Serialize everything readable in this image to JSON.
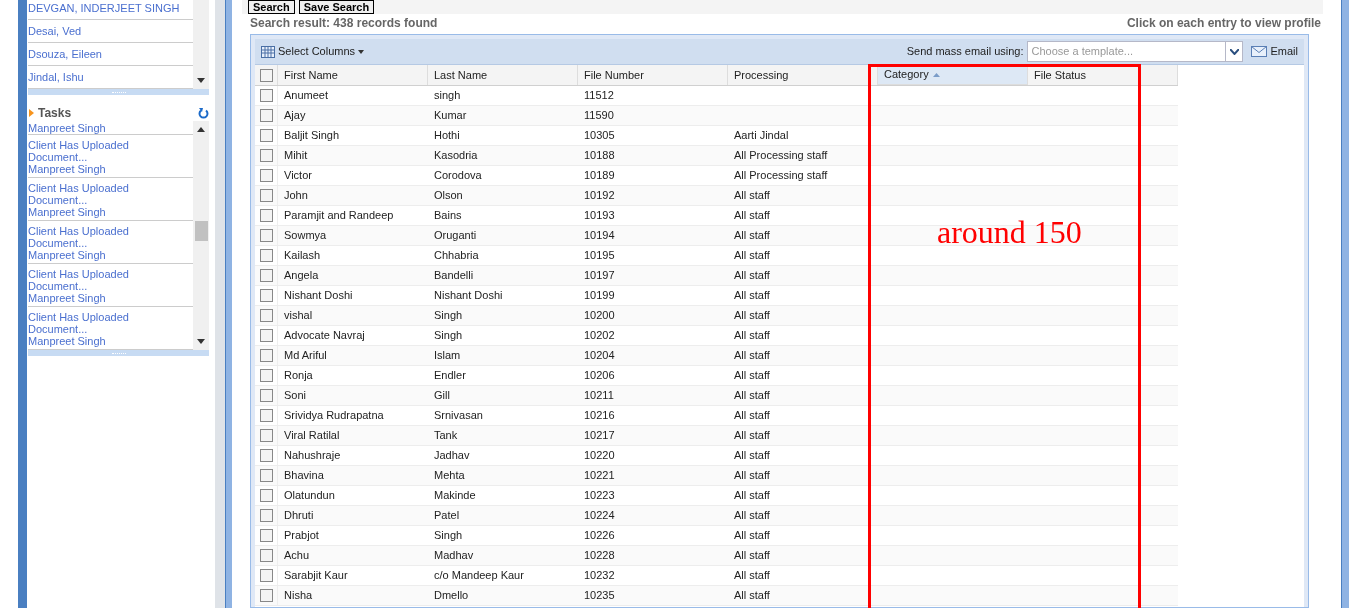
{
  "sidebar": {
    "clients": [
      "DEVGAN, INDERJEET SINGH",
      "Desai, Ved",
      "Dsouza, Eileen",
      "Jindal, Ishu"
    ],
    "tasks_title": "Tasks",
    "tasks_cut": "Manpreet Singh",
    "tasks": [
      {
        "title": "Client Has Uploaded Document...",
        "person": "Manpreet Singh"
      },
      {
        "title": "Client Has Uploaded Document...",
        "person": "Manpreet Singh"
      },
      {
        "title": "Client Has Uploaded Document...",
        "person": "Manpreet Singh"
      },
      {
        "title": "Client Has Uploaded Document...",
        "person": "Manpreet Singh"
      },
      {
        "title": "Client Has Uploaded Document...",
        "person": "Manpreet Singh"
      }
    ]
  },
  "search_buttons": [
    "Search",
    "Save Search"
  ],
  "result_text": "Search result: 438 records found",
  "hint": "Click on each entry to view profile",
  "toolbar": {
    "select_columns": "Select Columns",
    "mass_email_label": "Send mass email using:",
    "template": {
      "placeholder": "Choose a template..."
    },
    "email_button": "Email"
  },
  "table": {
    "select_all": {
      "checked": false
    },
    "columns": [
      {
        "label": "First Name",
        "sorted": false
      },
      {
        "label": "Last Name",
        "sorted": false
      },
      {
        "label": "File Number",
        "sorted": false
      },
      {
        "label": "Processing",
        "sorted": false
      },
      {
        "label": "Category",
        "sorted": true
      },
      {
        "label": "File Status",
        "sorted": false
      }
    ],
    "rows": [
      {
        "checked": false,
        "cells": [
          "Anumeet",
          "singh",
          "11512",
          ""
        ]
      },
      {
        "checked": false,
        "cells": [
          "Ajay",
          "Kumar",
          "11590",
          ""
        ]
      },
      {
        "checked": false,
        "cells": [
          "Baljit Singh",
          "Hothi",
          "10305",
          "Aarti Jindal"
        ]
      },
      {
        "checked": false,
        "cells": [
          "Mihit",
          "Kasodria",
          "10188",
          "All Processing staff"
        ]
      },
      {
        "checked": false,
        "cells": [
          "Victor",
          "Corodova",
          "10189",
          "All Processing staff"
        ]
      },
      {
        "checked": false,
        "cells": [
          "John",
          "Olson",
          "10192",
          "All staff"
        ]
      },
      {
        "checked": false,
        "cells": [
          "Paramjit and Randeep",
          "Bains",
          "10193",
          "All staff"
        ]
      },
      {
        "checked": false,
        "cells": [
          "Sowmya",
          "Oruganti",
          "10194",
          "All staff"
        ]
      },
      {
        "checked": false,
        "cells": [
          "Kailash",
          "Chhabria",
          "10195",
          "All staff"
        ]
      },
      {
        "checked": false,
        "cells": [
          "Angela",
          "Bandelli",
          "10197",
          "All staff"
        ]
      },
      {
        "checked": false,
        "cells": [
          "Nishant Doshi",
          "Nishant Doshi",
          "10199",
          "All staff"
        ]
      },
      {
        "checked": false,
        "cells": [
          "vishal",
          "Singh",
          "10200",
          "All staff"
        ]
      },
      {
        "checked": false,
        "cells": [
          "Advocate Navraj",
          "Singh",
          "10202",
          "All staff"
        ]
      },
      {
        "checked": false,
        "cells": [
          "Md Ariful",
          "Islam",
          "10204",
          "All staff"
        ]
      },
      {
        "checked": false,
        "cells": [
          "Ronja",
          "Endler",
          "10206",
          "All staff"
        ]
      },
      {
        "checked": false,
        "cells": [
          "Soni",
          "Gill",
          "10211",
          "All staff"
        ]
      },
      {
        "checked": false,
        "cells": [
          "Srividya Rudrapatna",
          "Srnivasan",
          "10216",
          "All staff"
        ]
      },
      {
        "checked": false,
        "cells": [
          "Viral Ratilal",
          "Tank",
          "10217",
          "All staff"
        ]
      },
      {
        "checked": false,
        "cells": [
          "Nahushraje",
          "Jadhav",
          "10220",
          "All staff"
        ]
      },
      {
        "checked": false,
        "cells": [
          "Bhavina",
          "Mehta",
          "10221",
          "All staff"
        ]
      },
      {
        "checked": false,
        "cells": [
          "Olatundun",
          "Makinde",
          "10223",
          "All staff"
        ]
      },
      {
        "checked": false,
        "cells": [
          "Dhruti",
          "Patel",
          "10224",
          "All staff"
        ]
      },
      {
        "checked": false,
        "cells": [
          "Prabjot",
          "Singh",
          "10226",
          "All staff"
        ]
      },
      {
        "checked": false,
        "cells": [
          "Achu",
          "Madhav",
          "10228",
          "All staff"
        ]
      },
      {
        "checked": false,
        "cells": [
          "Sarabjit Kaur",
          "c/o Mandeep Kaur",
          "10232",
          "All staff"
        ]
      },
      {
        "checked": false,
        "cells": [
          "Nisha",
          "Dmello",
          "10235",
          "All staff"
        ]
      }
    ]
  },
  "annotation": "around 150"
}
